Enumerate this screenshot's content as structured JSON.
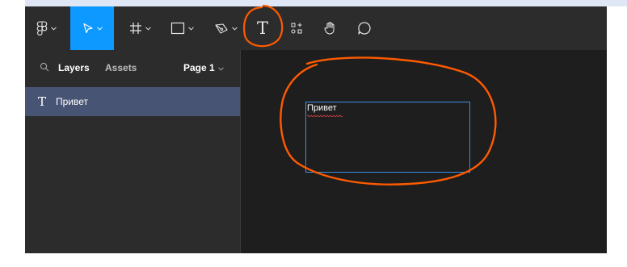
{
  "toolbar": {
    "tools": [
      {
        "name": "main-menu",
        "icon": "figma-logo-icon",
        "has_caret": true
      },
      {
        "name": "move",
        "icon": "cursor-arrow-icon",
        "has_caret": true,
        "active": true
      },
      {
        "name": "frame",
        "icon": "frame-hash-icon",
        "has_caret": true
      },
      {
        "name": "shape",
        "icon": "rectangle-icon",
        "has_caret": true
      },
      {
        "name": "pen",
        "icon": "pen-icon",
        "has_caret": true
      },
      {
        "name": "text",
        "icon": "text-t-icon",
        "has_caret": false
      },
      {
        "name": "resources",
        "icon": "resources-icon",
        "has_caret": false
      },
      {
        "name": "hand",
        "icon": "hand-icon",
        "has_caret": false
      },
      {
        "name": "comment",
        "icon": "comment-bubble-icon",
        "has_caret": false
      }
    ],
    "text_tool_glyph": "T"
  },
  "sidebar": {
    "tabs": {
      "layers": "Layers",
      "assets": "Assets"
    },
    "page_select": {
      "label": "Page 1"
    },
    "layers": [
      {
        "type_glyph": "T",
        "label": "Привет",
        "selected": true
      }
    ]
  },
  "canvas": {
    "text_layer": {
      "content": "Привет",
      "selected": true
    }
  },
  "colors": {
    "accent": "#0d99ff",
    "annotation": "#ff5a00",
    "selected_layer": "#485474",
    "selection_border": "#3f8ee8",
    "toolbar_bg": "#2c2c2c",
    "canvas_bg": "#1e1e1e"
  }
}
